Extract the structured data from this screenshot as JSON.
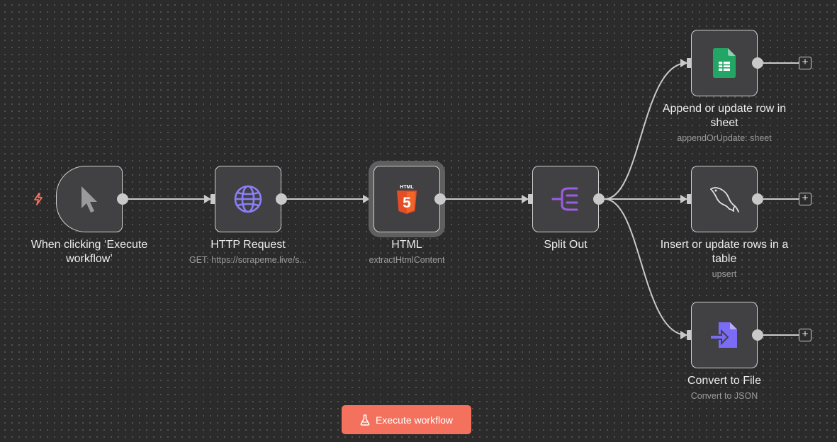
{
  "nodes": {
    "trigger": {
      "title": "When clicking ‘Execute workflow’",
      "icon": "cursor-icon"
    },
    "http": {
      "title": "HTTP Request",
      "subtitle": "GET: https://scrapeme.live/s...",
      "icon": "globe-icon"
    },
    "html": {
      "title": "HTML",
      "subtitle": "extractHtmlContent",
      "icon": "html5-icon",
      "icon_text": "HTML",
      "icon_glyph": "5"
    },
    "split": {
      "title": "Split Out",
      "icon": "split-out-icon"
    },
    "sheets": {
      "title": "Append or update row in sheet",
      "subtitle": "appendOrUpdate: sheet",
      "icon": "google-sheets-icon"
    },
    "mysql": {
      "title": "Insert or update rows in a table",
      "subtitle": "upsert",
      "icon": "mysql-dolphin-icon"
    },
    "convert": {
      "title": "Convert to File",
      "subtitle": "Convert to JSON",
      "icon": "convert-file-icon"
    }
  },
  "add_button_glyph": "+",
  "execute_button": {
    "label": "Execute workflow",
    "icon": "flask-icon"
  },
  "colors": {
    "canvas_bg": "#2b2b2b",
    "node_bg": "#414144",
    "accent_orange": "#f4715e",
    "trigger_bolt": "#f4715e",
    "globe": "#8b7ff6",
    "split_purple": "#9b5de5",
    "html5_orange": "#e44d26",
    "sheets_green": "#23a566",
    "convert_purple": "#7b6cf6"
  }
}
